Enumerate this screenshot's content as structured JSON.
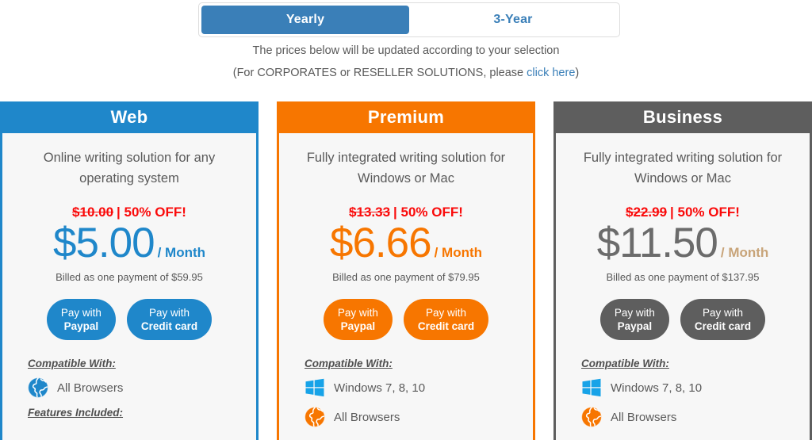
{
  "toggle": {
    "options": [
      {
        "label": "Yearly",
        "active": true
      },
      {
        "label": "3-Year",
        "active": false
      }
    ]
  },
  "subtitle": {
    "line1": "The prices below will be updated according to your selection",
    "line2_prefix": "(For CORPORATES or RESELLER SOLUTIONS, please ",
    "link_label": "click here",
    "line2_suffix": ")"
  },
  "labels": {
    "compatible_with": "Compatible With:",
    "features_included": "Features Included:",
    "paypal_line1": "Pay with",
    "paypal_line2": "Paypal",
    "card_line1": "Pay with",
    "card_line2": "Credit card",
    "discount": "| 50% OFF!",
    "per_month": "/ Month"
  },
  "colors": {
    "web": "#1f87ca",
    "premium": "#f77600",
    "business": "#5e5e5e",
    "globe_orange": "#f77600",
    "globe_blue": "#1f87ca",
    "windows_blue": "#17a3e8",
    "strike_red": "#fa0a0a",
    "link_blue": "#3a7fb8",
    "business_per_month": "#c8a479"
  },
  "plans": [
    {
      "name": "Web",
      "accent": "#1f87ca",
      "description": "Online writing solution for any operating system",
      "old_price": "$10.00",
      "discount": "| 50% OFF!",
      "price": "$5.00",
      "per": "/ Month",
      "billed": "Billed as one payment of $59.95",
      "price_color": "#1f87ca",
      "per_color": "#1f87ca",
      "compatible": [
        {
          "icon": "globe-icon",
          "label": "All Browsers",
          "icon_color": "#1f87ca"
        }
      ],
      "show_features_label": true
    },
    {
      "name": "Premium",
      "accent": "#f77600",
      "description": "Fully integrated writing solution for Windows or Mac",
      "old_price": "$13.33",
      "discount": "| 50% OFF!",
      "price": "$6.66",
      "per": "/ Month",
      "billed": "Billed as one payment of $79.95",
      "price_color": "#f77600",
      "per_color": "#f77600",
      "compatible": [
        {
          "icon": "windows-icon",
          "label": "Windows 7, 8, 10",
          "icon_color": "#17a3e8"
        },
        {
          "icon": "globe-icon",
          "label": "All Browsers",
          "icon_color": "#f77600"
        }
      ],
      "show_features_label": false
    },
    {
      "name": "Business",
      "accent": "#5e5e5e",
      "description": "Fully integrated writing solution for Windows or Mac",
      "old_price": "$22.99",
      "discount": "| 50% OFF!",
      "price": "$11.50",
      "per": "/ Month",
      "billed": "Billed as one payment of $137.95",
      "price_color": "#6b6b6b",
      "per_color": "#c8a479",
      "compatible": [
        {
          "icon": "windows-icon",
          "label": "Windows 7, 8, 10",
          "icon_color": "#17a3e8"
        },
        {
          "icon": "globe-icon",
          "label": "All Browsers",
          "icon_color": "#f77600"
        }
      ],
      "show_features_label": false
    }
  ]
}
